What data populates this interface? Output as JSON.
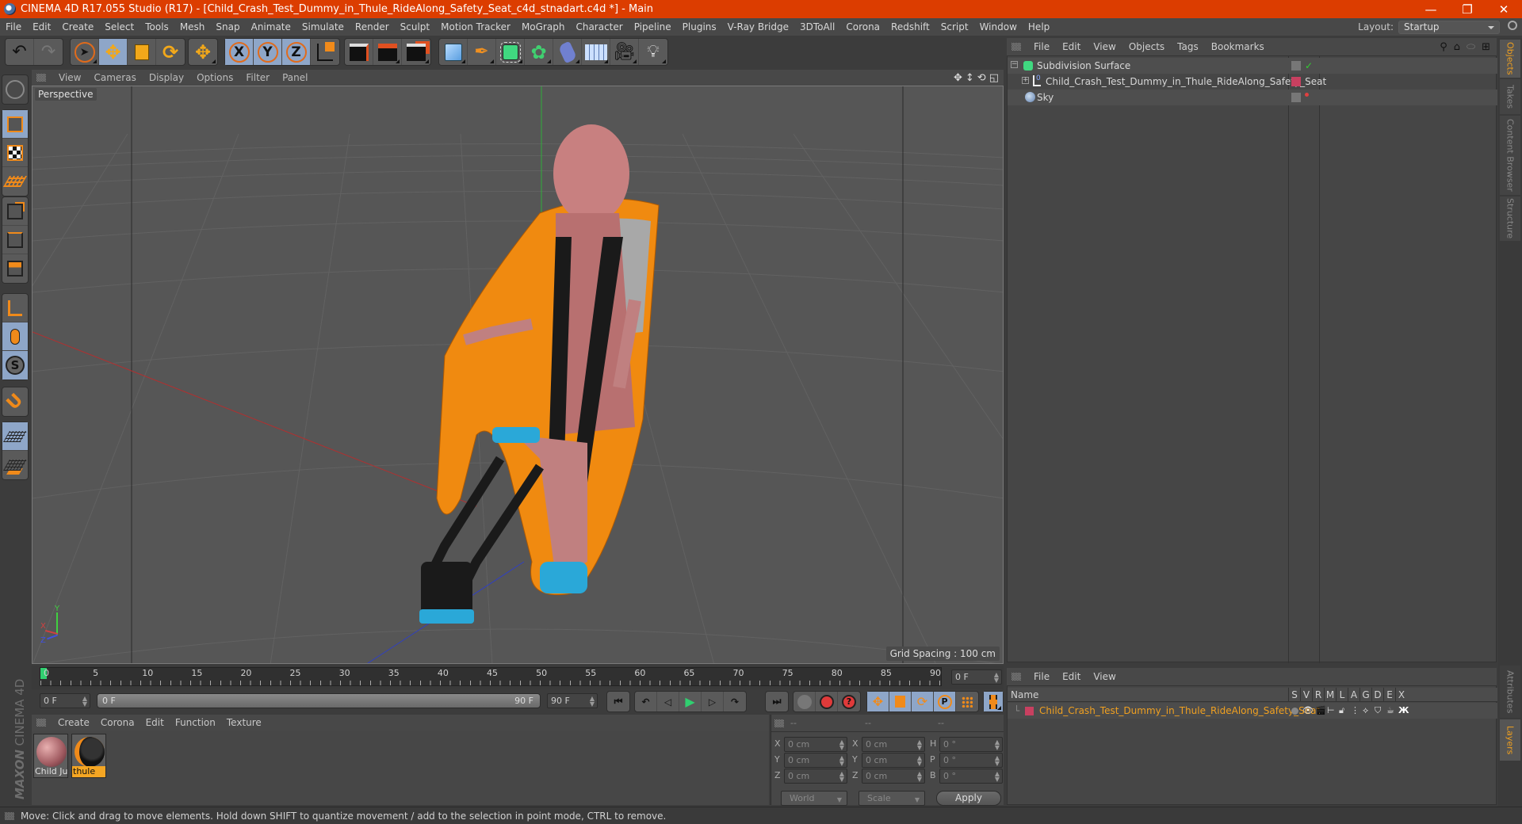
{
  "window": {
    "title": "CINEMA 4D R17.055 Studio (R17) - [Child_Crash_Test_Dummy_in_Thule_RideAlong_Safety_Seat_c4d_stnadart.c4d *] - Main",
    "minimize": "—",
    "restore": "❐",
    "close": "✕"
  },
  "menubar": [
    "File",
    "Edit",
    "Create",
    "Select",
    "Tools",
    "Mesh",
    "Snap",
    "Animate",
    "Simulate",
    "Render",
    "Sculpt",
    "Motion Tracker",
    "MoGraph",
    "Character",
    "Pipeline",
    "Plugins",
    "V-Ray Bridge",
    "3DToAll",
    "Corona",
    "Redshift",
    "Script",
    "Window",
    "Help"
  ],
  "layout": {
    "label": "Layout:",
    "value": "Startup"
  },
  "toolbar": {
    "undo": "undo-icon",
    "redo": "redo-icon",
    "axis": [
      "X",
      "Y",
      "Z"
    ]
  },
  "viewport": {
    "menu": [
      "View",
      "Cameras",
      "Display",
      "Options",
      "Filter",
      "Panel"
    ],
    "camera_label": "Perspective",
    "grid_spacing": "Grid Spacing : 100 cm",
    "axis_labels": {
      "x": "X",
      "y": "Y",
      "z": "Z"
    }
  },
  "timeline": {
    "ticks": [
      "0",
      "5",
      "10",
      "15",
      "20",
      "25",
      "30",
      "35",
      "40",
      "45",
      "50",
      "55",
      "60",
      "65",
      "70",
      "75",
      "80",
      "85",
      "90"
    ],
    "current_frame": "0 F",
    "start_field": "0 F",
    "range_start": "0 F",
    "range_end": "90 F",
    "end_field": "90 F",
    "playhead_fraction": 0.0
  },
  "material_manager": {
    "menu": [
      "Create",
      "Corona",
      "Edit",
      "Function",
      "Texture"
    ],
    "materials": [
      {
        "name": "Child Ju",
        "selected": false
      },
      {
        "name": "thule",
        "selected": true
      }
    ]
  },
  "branding": {
    "maxon": "MAXON",
    "product": "CINEMA 4D"
  },
  "coordinates": {
    "headers": [
      "--",
      "--",
      "--"
    ],
    "rows": [
      {
        "l1": "X",
        "v1": "0 cm",
        "l2": "X",
        "v2": "0 cm",
        "l3": "H",
        "v3": "0 °"
      },
      {
        "l1": "Y",
        "v1": "0 cm",
        "l2": "Y",
        "v2": "0 cm",
        "l3": "P",
        "v3": "0 °"
      },
      {
        "l1": "Z",
        "v1": "0 cm",
        "l2": "Z",
        "v2": "0 cm",
        "l3": "B",
        "v3": "0 °"
      }
    ],
    "space": "World",
    "mode": "Scale",
    "apply": "Apply"
  },
  "object_manager": {
    "menu": [
      "File",
      "Edit",
      "View",
      "Objects",
      "Tags",
      "Bookmarks"
    ],
    "objects": [
      {
        "name": "Subdivision Surface",
        "icon": "subdivision-icon",
        "indent": 0
      },
      {
        "name": "Child_Crash_Test_Dummy_in_Thule_RideAlong_Safety_Seat",
        "icon": "null-object-icon",
        "indent": 1
      },
      {
        "name": "Sky",
        "icon": "sky-icon",
        "indent": 0
      }
    ]
  },
  "layer_manager": {
    "menu": [
      "File",
      "Edit",
      "View"
    ],
    "columns": [
      "Name",
      "S",
      "V",
      "R",
      "M",
      "L",
      "A",
      "G",
      "D",
      "E",
      "X"
    ],
    "layers": [
      {
        "name": "Child_Crash_Test_Dummy_in_Thule_RideAlong_Safety_Seat",
        "color": "#c84060"
      }
    ]
  },
  "side_tabs": {
    "top": [
      "Objects",
      "Takes",
      "Content Browser",
      "Structure"
    ],
    "bottom": [
      "Attributes",
      "Layers"
    ]
  },
  "status": "Move: Click and drag to move elements. Hold down SHIFT to quantize movement / add to the selection in point mode, CTRL to remove.",
  "colors": {
    "titlebar": "#dc3d00",
    "accent": "#f0a020",
    "active_tool": "#8ea6c8"
  }
}
